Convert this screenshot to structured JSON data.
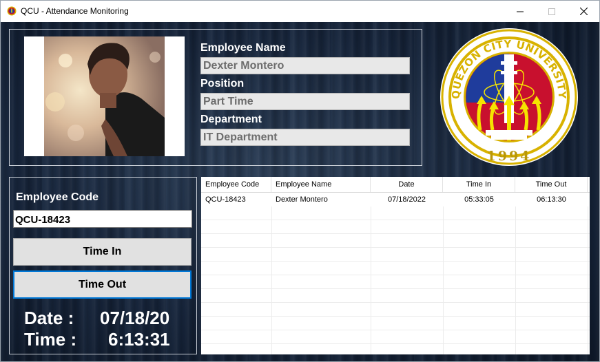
{
  "window": {
    "title": "QCU - Attendance Monitoring",
    "icon": "qcu-logo-icon",
    "controls": [
      "minimize-icon",
      "maximize-icon",
      "close-icon"
    ]
  },
  "profile": {
    "photo": "employee-photo",
    "name_label": "Employee Name",
    "name_value": "Dexter Montero",
    "position_label": "Position",
    "position_value": "Part Time",
    "department_label": "Department",
    "department_value": "IT Department"
  },
  "logo": {
    "name": "quezon-city-university-seal",
    "arc_text": "QUEZON CITY UNIVERSITY",
    "year": "1994",
    "colors": {
      "outer": "#ffffff",
      "ring": "#c8102e",
      "gold": "#d8b200",
      "blue": "#1f3c9c",
      "yellow": "#f5e400"
    }
  },
  "entry": {
    "code_label": "Employee Code",
    "code_value": "QCU-18423",
    "time_in_label": "Time In",
    "time_out_label": "Time Out",
    "date_label": "Date :",
    "date_value": "07/18/20",
    "time_label": "Time :",
    "time_value": "6:13:31"
  },
  "table": {
    "columns": [
      "Employee Code",
      "Employee Name",
      "Date",
      "Time In",
      "Time Out"
    ],
    "rows": [
      [
        "QCU-18423",
        "Dexter Montero",
        "07/18/2022",
        "05:33:05",
        "06:13:30"
      ]
    ]
  },
  "colors": {
    "background_dark": "#16243a",
    "field_bg": "#e8e8e8",
    "focus_border": "#0078d7"
  }
}
